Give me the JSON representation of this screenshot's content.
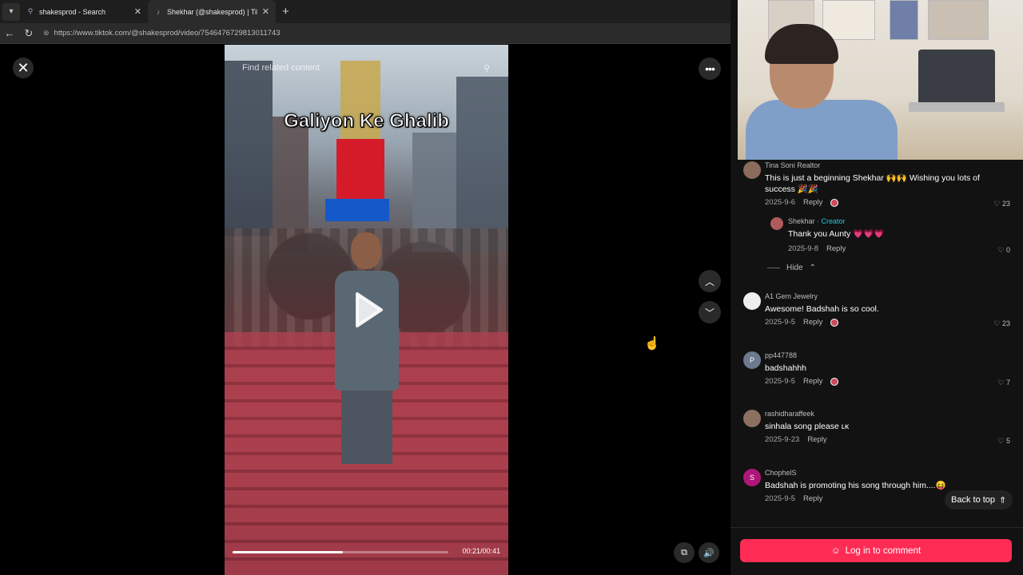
{
  "browser": {
    "tabs": [
      {
        "title": "shakesprod - Search",
        "icon": "search-icon",
        "active": false
      },
      {
        "title": "Shekhar (@shakesprod) | TikTok",
        "icon": "tiktok-icon",
        "active": true
      }
    ],
    "url": "https://www.tiktok.com/@shakesprod/video/7546476729813011743"
  },
  "video": {
    "search_placeholder": "Find related content",
    "caption": "Galiyon Ke Ghalib",
    "progress": 0.51,
    "time": "00:21/00:41"
  },
  "comments": [
    {
      "user": "Tina Soni Realtor",
      "text": "This is just a beginning Shekhar 🙌🙌 Wishing you lots of success 🎉🎉",
      "date": "2025-9-6",
      "reply": "Reply",
      "likes": "23",
      "avatar": "avatar",
      "liked_by_creator": true
    },
    {
      "user": "Shekhar",
      "creator_tag": " · Creator",
      "text": "Thank you Aunty 💗💗💗",
      "date": "2025-9-8",
      "reply": "Reply",
      "likes": "0",
      "avatar": "avatar",
      "is_reply": true
    },
    {
      "user": "A1 Gem Jewelry",
      "text": "Awesome! Badshah is so cool.",
      "date": "2025-9-5",
      "reply": "Reply",
      "likes": "23",
      "avatar": "avatar",
      "liked_by_creator": true
    },
    {
      "user": "pp447788",
      "avatar_letter": "P",
      "text": "badshahhh",
      "date": "2025-9-5",
      "reply": "Reply",
      "likes": "7",
      "liked_by_creator": true
    },
    {
      "user": "rashidharaffeek",
      "text": "sinhala song please ʟᴋ",
      "date": "2025-9-23",
      "reply": "Reply",
      "likes": "5"
    },
    {
      "user": "ChophelS",
      "avatar_letter": "S",
      "text": "Badshah is promoting his song through him....😝",
      "date": "2025-9-5",
      "reply": "Reply",
      "likes": ""
    }
  ],
  "hide_label": "Hide",
  "back_to_top": "Back to top",
  "login_button": "Log in to comment",
  "colors": {
    "accent": "#fe2c55",
    "creator": "#25c5d6",
    "panel_bg": "#121212"
  }
}
